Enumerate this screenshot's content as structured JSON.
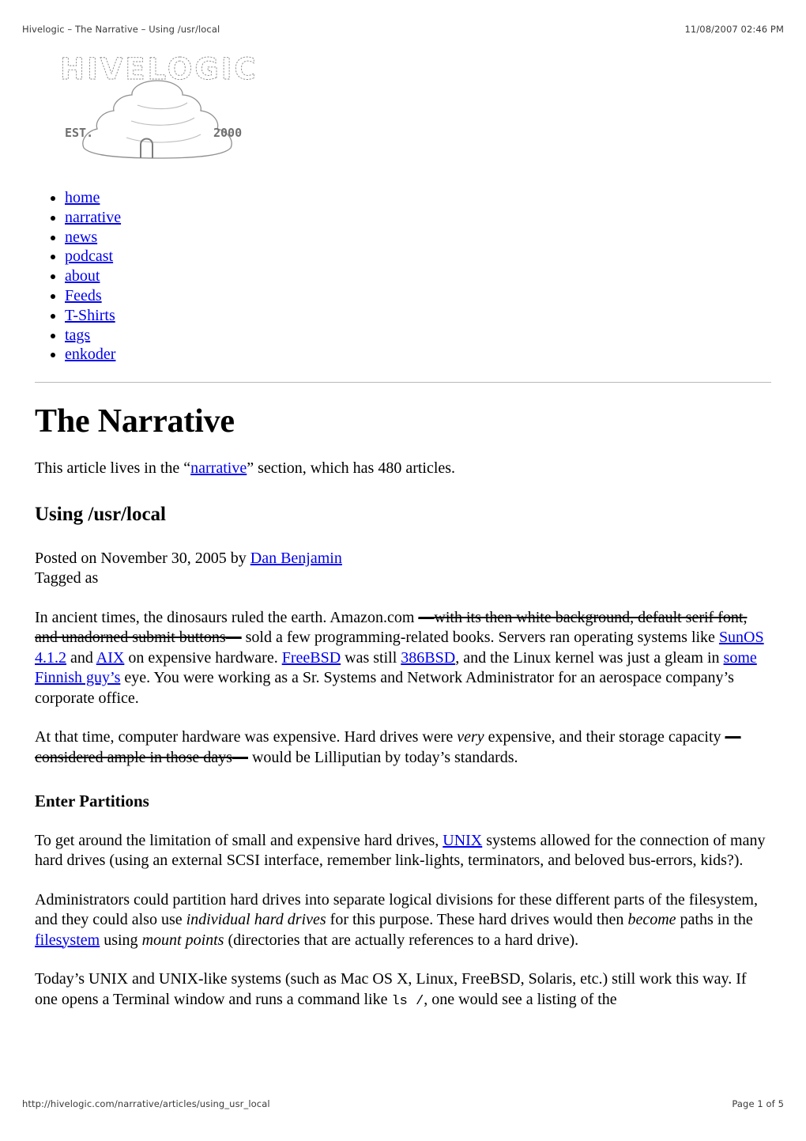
{
  "print": {
    "header_title": "Hivelogic – The Narrative – Using /usr/local",
    "header_timestamp": "11/08/2007 02:46 PM",
    "footer_url": "http://hivelogic.com/narrative/articles/using_usr_local",
    "footer_page": "Page 1 of 5"
  },
  "logo": {
    "wordmark": "HIVELOGIC",
    "est_label": "EST.",
    "est_year": "2000",
    "icon": "beehive-icon"
  },
  "nav": {
    "items": [
      {
        "label": "home"
      },
      {
        "label": "narrative"
      },
      {
        "label": "news"
      },
      {
        "label": "podcast"
      },
      {
        "label": "about"
      },
      {
        "label": "Feeds"
      },
      {
        "label": "T-Shirts"
      },
      {
        "label": "tags"
      },
      {
        "label": "enkoder"
      }
    ]
  },
  "article": {
    "site_title": "The Narrative",
    "section_note": {
      "pre": "This article lives in the “",
      "link": "narrative",
      "post": "” section, which has 480 articles."
    },
    "title": "Using /usr/local",
    "byline": {
      "pre": "Posted on November 30, 2005 by ",
      "author": "Dan Benjamin",
      "tagged_label": "Tagged as"
    },
    "paragraphs": {
      "p1": {
        "t1": "In ancient times, the dinosaurs ruled the earth. Amazon.com ",
        "del1": "—with its then white background, default serif font, and unadorned submit buttons—",
        "t2": " sold a few programming-related books. Servers ran operating systems like ",
        "link1": "SunOS 4.1.2",
        "t3": " and ",
        "link2": "AIX",
        "t4": " on expensive hardware. ",
        "link3": "FreeBSD",
        "t5": " was still ",
        "link4": "386BSD",
        "t6": ", and the Linux kernel was just a gleam in ",
        "link5": "some Finnish guy’s",
        "t7": " eye. You were working as a Sr. Systems and Network Administrator for an aerospace company’s corporate office."
      },
      "p2": {
        "t1": "At that time, computer hardware was expensive. Hard drives were ",
        "ital1": "very",
        "t2": " expensive, and their storage capacity ",
        "del1": "—considered ample in those days—",
        "t3": " would be Lilliputian by today’s standards."
      },
      "section_heading": "Enter Partitions",
      "p3": {
        "t1": "To get around the limitation of small and expensive hard drives, ",
        "link1": "UNIX",
        "t2": " systems allowed for the connection of many hard drives (using an external SCSI interface, remember link-lights, terminators, and beloved bus-errors, kids?)."
      },
      "p4": {
        "t1": "Administrators could partition hard drives into separate logical divisions for these different parts of the filesystem, and they could also use ",
        "ital1": "individual hard drives",
        "t2": " for this purpose. These hard drives would then ",
        "ital2": "become",
        "t3": " paths in the ",
        "link1": "filesystem",
        "t4": " using ",
        "ital3": "mount points",
        "t5": " (directories that are actually references to a hard drive)."
      },
      "p5": {
        "t1": "Today’s UNIX and UNIX-like systems (such as Mac OS X, Linux, FreeBSD, Solaris, etc.) still work this way. If one opens a Terminal window and runs a command like ",
        "code1": "ls /",
        "t2": ", one would see a listing of the"
      }
    }
  },
  "colors": {
    "link": "#0000ee",
    "text": "#000000",
    "rule": "#b9b9b9",
    "chrome_text": "#3a3a3a"
  }
}
